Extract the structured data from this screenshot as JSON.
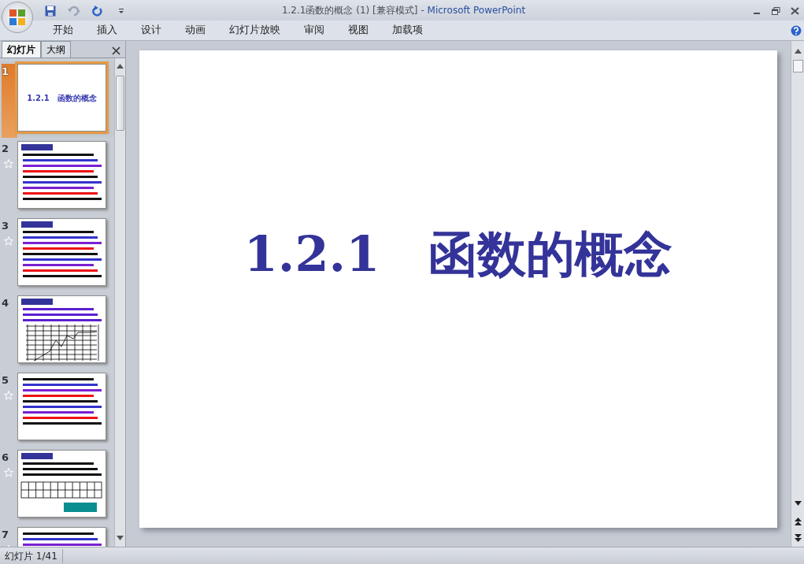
{
  "window": {
    "title": "1.2.1函数的概念 (1) [兼容模式]",
    "app_name": "- Microsoft PowerPoint"
  },
  "ribbon_tabs": [
    {
      "label": "开始"
    },
    {
      "label": "插入"
    },
    {
      "label": "设计"
    },
    {
      "label": "动画"
    },
    {
      "label": "幻灯片放映"
    },
    {
      "label": "审阅"
    },
    {
      "label": "视图"
    },
    {
      "label": "加载项"
    }
  ],
  "pane_tabs": [
    {
      "label": "幻灯片",
      "selected": true
    },
    {
      "label": "大纲",
      "selected": false
    }
  ],
  "slides": [
    {
      "number": "1",
      "selected": true,
      "animated": false,
      "kind": "title",
      "title": "1.2.1　函数的概念"
    },
    {
      "number": "2",
      "selected": false,
      "animated": true,
      "kind": "text",
      "has_header": true
    },
    {
      "number": "3",
      "selected": false,
      "animated": true,
      "kind": "text",
      "has_header": true
    },
    {
      "number": "4",
      "selected": false,
      "animated": false,
      "kind": "chart",
      "has_header": true
    },
    {
      "number": "5",
      "selected": false,
      "animated": true,
      "kind": "text"
    },
    {
      "number": "6",
      "selected": false,
      "animated": true,
      "kind": "table",
      "has_header": true
    },
    {
      "number": "7",
      "selected": false,
      "animated": true,
      "kind": "text"
    }
  ],
  "main_slide": {
    "title": "1.2.1　函数的概念"
  },
  "status_bar": {
    "slide_counter": "幻灯片 1/41"
  }
}
